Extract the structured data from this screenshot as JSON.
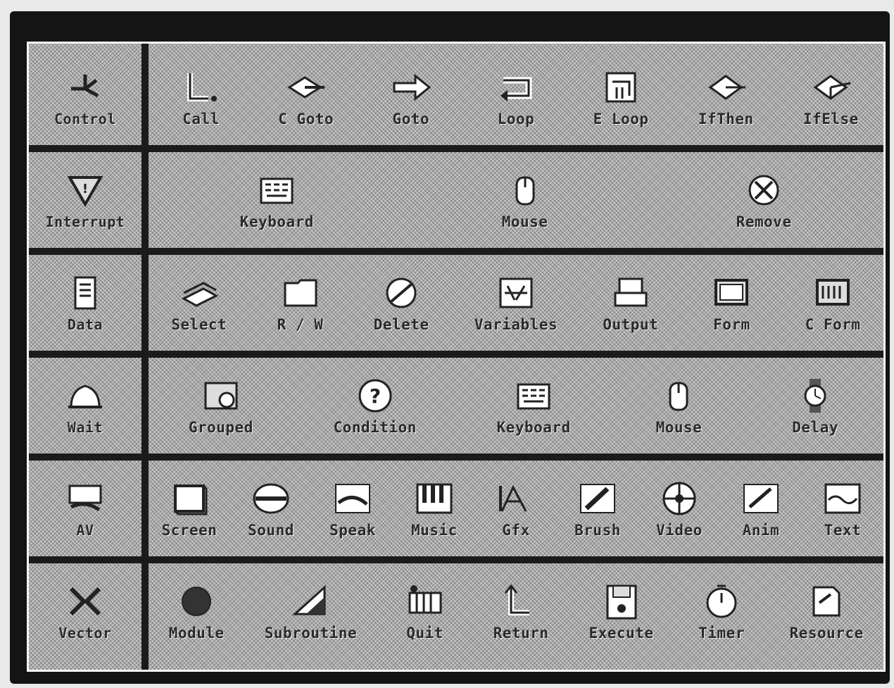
{
  "rows": [
    {
      "category": {
        "label": "Control",
        "icon": "control-icon"
      },
      "items": [
        {
          "label": "Call",
          "icon": "call-icon"
        },
        {
          "label": "C Goto",
          "icon": "cgoto-icon"
        },
        {
          "label": "Goto",
          "icon": "goto-icon"
        },
        {
          "label": "Loop",
          "icon": "loop-icon"
        },
        {
          "label": "E Loop",
          "icon": "eloop-icon"
        },
        {
          "label": "IfThen",
          "icon": "ifthen-icon"
        },
        {
          "label": "IfElse",
          "icon": "ifelse-icon"
        }
      ]
    },
    {
      "category": {
        "label": "Interrupt",
        "icon": "interrupt-icon"
      },
      "items": [
        {
          "label": "Keyboard",
          "icon": "keyboard-icon"
        },
        {
          "label": "Mouse",
          "icon": "mouse-icon"
        },
        {
          "label": "Remove",
          "icon": "remove-icon"
        }
      ]
    },
    {
      "category": {
        "label": "Data",
        "icon": "data-icon"
      },
      "items": [
        {
          "label": "Select",
          "icon": "select-icon"
        },
        {
          "label": "R / W",
          "icon": "read-write-icon"
        },
        {
          "label": "Delete",
          "icon": "delete-icon"
        },
        {
          "label": "Variables",
          "icon": "variables-icon"
        },
        {
          "label": "Output",
          "icon": "output-icon"
        },
        {
          "label": "Form",
          "icon": "form-icon"
        },
        {
          "label": "C Form",
          "icon": "cform-icon"
        }
      ]
    },
    {
      "category": {
        "label": "Wait",
        "icon": "wait-icon"
      },
      "items": [
        {
          "label": "Grouped",
          "icon": "grouped-icon"
        },
        {
          "label": "Condition",
          "icon": "condition-icon"
        },
        {
          "label": "Keyboard",
          "icon": "keyboard-icon"
        },
        {
          "label": "Mouse",
          "icon": "mouse-icon"
        },
        {
          "label": "Delay",
          "icon": "delay-icon"
        }
      ]
    },
    {
      "category": {
        "label": "AV",
        "icon": "av-icon"
      },
      "items": [
        {
          "label": "Screen",
          "icon": "screen-icon"
        },
        {
          "label": "Sound",
          "icon": "sound-icon"
        },
        {
          "label": "Speak",
          "icon": "speak-icon"
        },
        {
          "label": "Music",
          "icon": "music-icon"
        },
        {
          "label": "Gfx",
          "icon": "gfx-icon"
        },
        {
          "label": "Brush",
          "icon": "brush-icon"
        },
        {
          "label": "Video",
          "icon": "video-icon"
        },
        {
          "label": "Anim",
          "icon": "anim-icon"
        },
        {
          "label": "Text",
          "icon": "text-icon"
        }
      ]
    },
    {
      "category": {
        "label": "Vector",
        "icon": "vector-icon"
      },
      "items": [
        {
          "label": "Module",
          "icon": "module-icon"
        },
        {
          "label": "Subroutine",
          "icon": "subroutine-icon"
        },
        {
          "label": "Quit",
          "icon": "quit-icon"
        },
        {
          "label": "Return",
          "icon": "return-icon"
        },
        {
          "label": "Execute",
          "icon": "execute-icon"
        },
        {
          "label": "Timer",
          "icon": "timer-icon"
        },
        {
          "label": "Resource",
          "icon": "resource-icon"
        }
      ]
    }
  ]
}
